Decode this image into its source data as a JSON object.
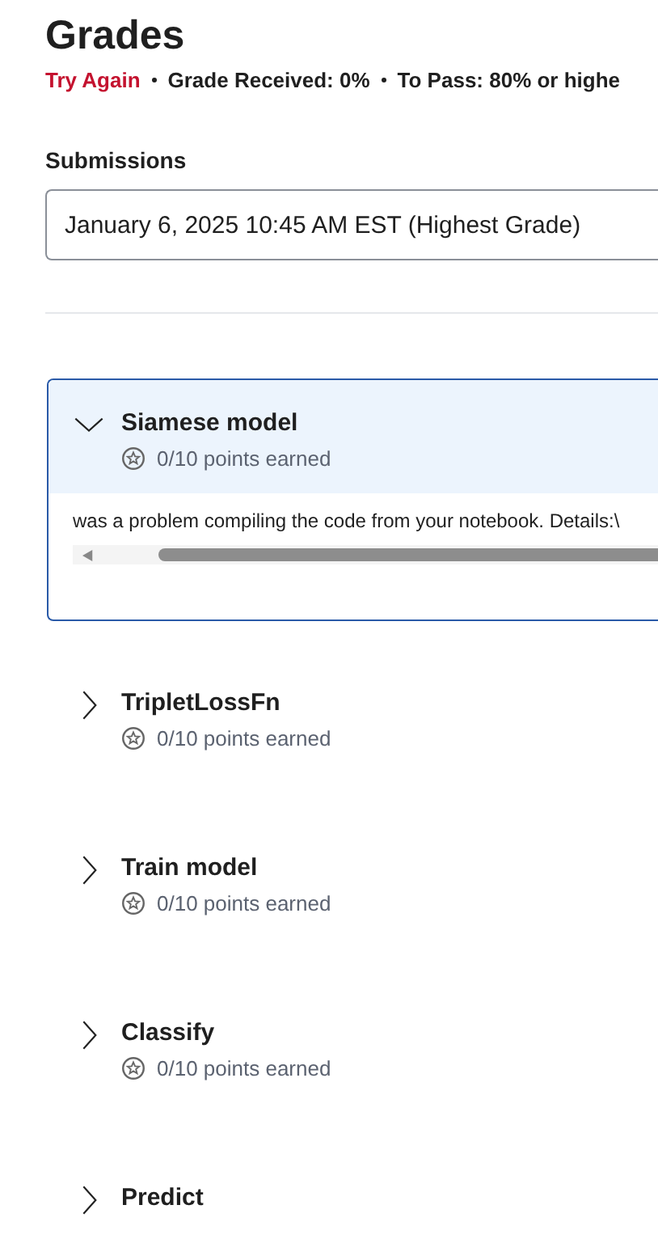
{
  "title": "Grades",
  "status": {
    "result": "Try Again",
    "grade": "Grade Received: 0%",
    "to_pass": "To Pass: 80% or highe"
  },
  "submissions": {
    "label": "Submissions",
    "value": "January 6, 2025 10:45 AM EST (Highest Grade)"
  },
  "items": [
    {
      "title": "Siamese model",
      "points": "0/10 points earned",
      "expanded": true,
      "detail": "was a problem compiling the code from your notebook. Details:\\"
    },
    {
      "title": "TripletLossFn",
      "points": "0/10 points earned",
      "expanded": false
    },
    {
      "title": "Train model",
      "points": "0/10 points earned",
      "expanded": false
    },
    {
      "title": "Classify",
      "points": "0/10 points earned",
      "expanded": false
    },
    {
      "title": "Predict",
      "expanded": false
    }
  ]
}
